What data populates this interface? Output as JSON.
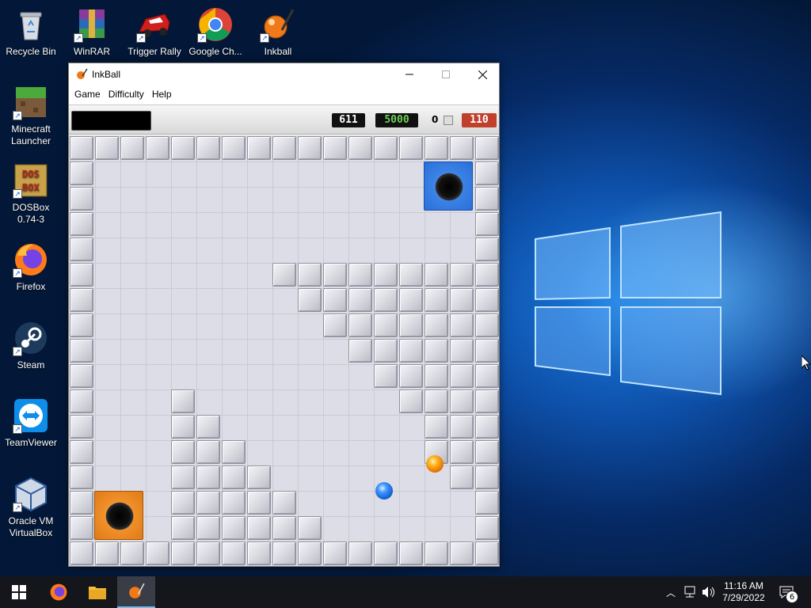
{
  "desktop": {
    "icons": [
      {
        "label": "Recycle Bin",
        "icon": "recycle-bin-icon"
      },
      {
        "label": "WinRAR",
        "icon": "winrar-icon"
      },
      {
        "label": "Trigger Rally",
        "icon": "trigger-rally-icon"
      },
      {
        "label": "Google Ch...",
        "icon": "google-chrome-icon"
      },
      {
        "label": "Inkball",
        "icon": "inkball-icon"
      },
      {
        "label": "Minecraft Launcher",
        "icon": "minecraft-icon"
      },
      {
        "label": "DOSBox 0.74-3",
        "icon": "dosbox-icon"
      },
      {
        "label": "Firefox",
        "icon": "firefox-icon"
      },
      {
        "label": "Steam",
        "icon": "steam-icon"
      },
      {
        "label": "TeamViewer",
        "icon": "teamviewer-icon"
      },
      {
        "label": "Oracle VM VirtualBox",
        "icon": "virtualbox-icon"
      }
    ]
  },
  "window": {
    "title": "InkBall",
    "menu": [
      "Game",
      "Difficulty",
      "Help"
    ],
    "scorebar": {
      "player_name": "",
      "time": "611",
      "score": "5000",
      "balls_captured": "0",
      "remaining": "110"
    },
    "board": {
      "holes": [
        {
          "color": "blue"
        },
        {
          "color": "orange"
        }
      ],
      "balls": [
        {
          "color": "orange"
        },
        {
          "color": "blue"
        }
      ]
    }
  },
  "taskbar": {
    "pinned": [
      "start-icon",
      "firefox-icon",
      "file-explorer-icon",
      "inkball-icon"
    ],
    "clock": {
      "time": "11:16 AM",
      "date": "7/29/2022"
    },
    "notifications": "6"
  },
  "colors": {
    "accent": "#76b9ed",
    "taskbar": "#14161c",
    "remaining_badge": "#c0402c",
    "score_text": "#6fcf5a"
  }
}
